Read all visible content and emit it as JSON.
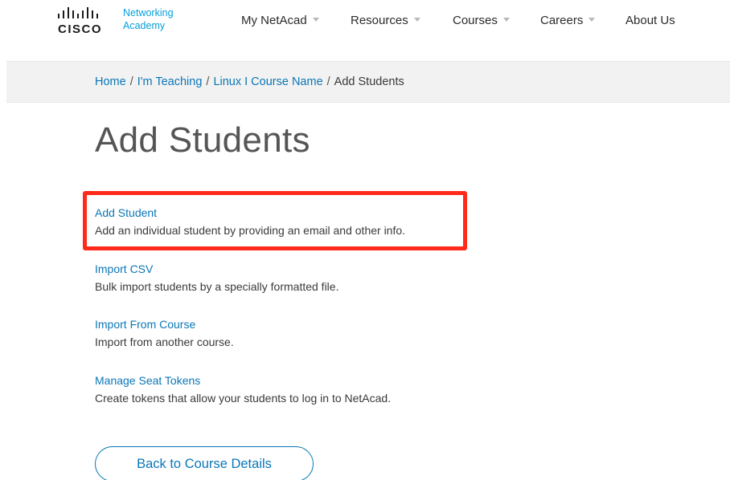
{
  "brand": {
    "wordmark": "CISCO",
    "subtitle_line1": "Networking",
    "subtitle_line2": "Academy",
    "accent_color": "#049fd9"
  },
  "nav": {
    "items": [
      {
        "label": "My NetAcad",
        "has_dropdown": true
      },
      {
        "label": "Resources",
        "has_dropdown": true
      },
      {
        "label": "Courses",
        "has_dropdown": true
      },
      {
        "label": "Careers",
        "has_dropdown": true
      },
      {
        "label": "About Us",
        "has_dropdown": false
      }
    ]
  },
  "breadcrumb": {
    "items": [
      "Home",
      "I'm Teaching",
      "Linux I Course Name"
    ],
    "separator": "/",
    "current": "Add Students"
  },
  "page": {
    "title": "Add Students"
  },
  "options": [
    {
      "link": "Add Student",
      "description": "Add an individual student by providing an email and other info.",
      "highlighted": true
    },
    {
      "link": "Import CSV",
      "description": "Bulk import students by a specially formatted file."
    },
    {
      "link": "Import From Course",
      "description": "Import from another course."
    },
    {
      "link": "Manage Seat Tokens",
      "description": "Create tokens that allow your students to log in to NetAcad."
    }
  ],
  "actions": {
    "back_label": "Back to Course Details"
  },
  "colors": {
    "link": "#0a76b7",
    "highlight": "#ff2a1a",
    "breadcrumb_bg": "#f2f2f2"
  }
}
